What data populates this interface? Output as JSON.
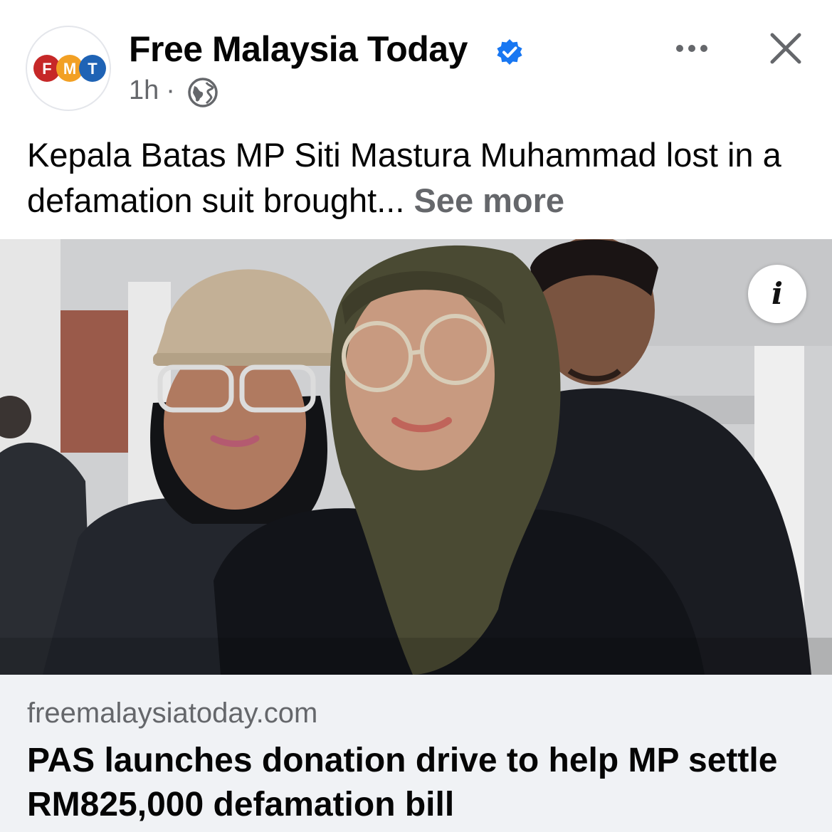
{
  "post": {
    "page_name": "Free Malaysia Today",
    "logo_letters": [
      "F",
      "M",
      "T"
    ],
    "logo_colors": [
      "#c62828",
      "#f2a024",
      "#1f63b5"
    ],
    "verified_icon": "verified-badge-icon",
    "timestamp": "1h",
    "separator": "·",
    "audience_icon": "globe-icon",
    "more_icon": "more-options-icon",
    "close_icon": "close-icon",
    "caption": "Kepala Batas MP Siti Mastura Muhammad lost in a defamation suit brought...",
    "see_more": "See more"
  },
  "image": {
    "info_icon": "info-icon",
    "info_label": "i"
  },
  "link": {
    "domain": "freemalaysiatoday.com",
    "headline": "PAS launches donation drive to help MP settle RM825,000 defamation bill"
  },
  "colors": {
    "verified_blue": "#1877f2",
    "secondary_text": "#65676b",
    "link_card_bg": "#f0f2f5"
  }
}
